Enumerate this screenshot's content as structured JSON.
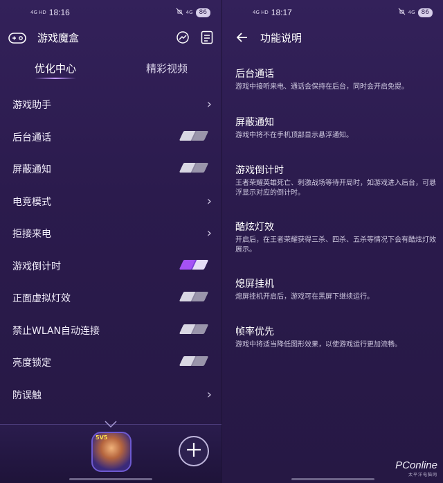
{
  "left_screen": {
    "status_bar": {
      "network": "4G HD",
      "time": "18:16",
      "signal": "4G",
      "battery": "86"
    },
    "header": {
      "title": "游戏魔盒",
      "icons": [
        "gamepad-icon",
        "speed-icon",
        "notes-icon"
      ]
    },
    "tabs": [
      {
        "label": "优化中心",
        "active": true
      },
      {
        "label": "精彩视频",
        "active": false
      }
    ],
    "settings": [
      {
        "label": "游戏助手",
        "control": "chevron"
      },
      {
        "label": "后台通话",
        "control": "toggle",
        "on": false
      },
      {
        "label": "屏蔽通知",
        "control": "toggle",
        "on": false
      },
      {
        "label": "电竞模式",
        "control": "chevron"
      },
      {
        "label": "拒接来电",
        "control": "chevron"
      },
      {
        "label": "游戏倒计时",
        "control": "toggle",
        "on": true
      },
      {
        "label": "正面虚拟灯效",
        "control": "toggle",
        "on": false
      },
      {
        "label": "禁止WLAN自动连接",
        "control": "toggle",
        "on": false
      },
      {
        "label": "亮度锁定",
        "control": "toggle",
        "on": false
      },
      {
        "label": "防误触",
        "control": "chevron"
      }
    ],
    "bottom": {
      "game_badge": "5V5",
      "add_icon": "plus-icon"
    }
  },
  "right_screen": {
    "status_bar": {
      "network": "4G HD",
      "time": "18:17",
      "signal": "4G",
      "battery": "86"
    },
    "header": {
      "title": "功能说明",
      "back_icon": "back-arrow-icon"
    },
    "items": [
      {
        "title": "后台通话",
        "desc": "游戏中接听来电、通话会保持在后台，同时会开启免提。"
      },
      {
        "title": "屏蔽通知",
        "desc": "游戏中将不在手机顶部显示悬浮通知。"
      },
      {
        "title": "游戏倒计时",
        "desc": "王者荣耀英雄死亡、刺激战场等待开局时，如游戏进入后台，可悬浮显示对应的倒计时。"
      },
      {
        "title": "酷炫灯效",
        "desc": "开启后，在王者荣耀获得三杀、四杀、五杀等情况下会有酷炫灯效展示。"
      },
      {
        "title": "熄屏挂机",
        "desc": "熄屏挂机开启后，游戏可在黑屏下继续运行。"
      },
      {
        "title": "帧率优先",
        "desc": "游戏中将适当降低图形效果，以使游戏运行更加流畅。"
      }
    ],
    "watermark": {
      "main": "PConline",
      "sub": "太平洋电脑网"
    }
  },
  "colors": {
    "accent": "#a552f5",
    "background": "#2b1b4d",
    "text": "#ffffff",
    "muted": "#cfc9e0"
  }
}
